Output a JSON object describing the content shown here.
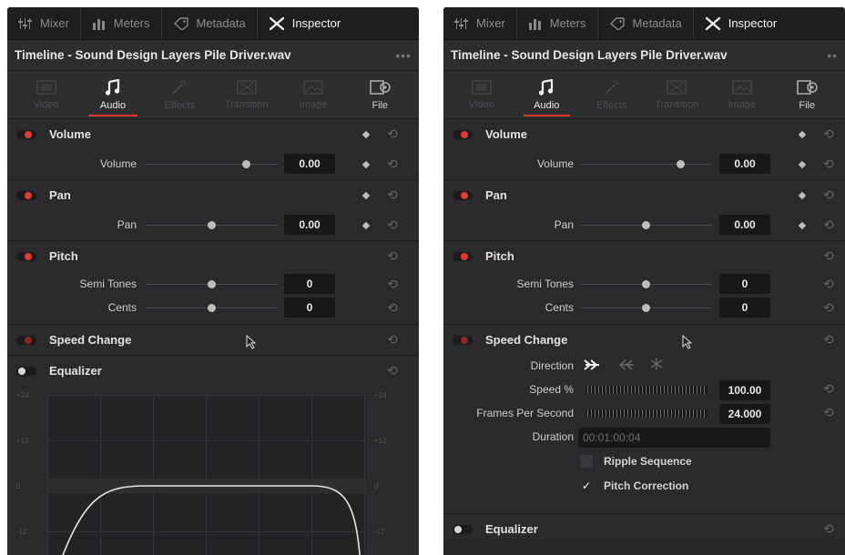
{
  "tabs_top": [
    "Mixer",
    "Meters",
    "Metadata",
    "Inspector"
  ],
  "title": "Timeline - Sound Design Layers Pile Driver.wav",
  "inspector_tabs": [
    "Video",
    "Audio",
    "Effects",
    "Transition",
    "Image",
    "File"
  ],
  "volume": {
    "section": "Volume",
    "label": "Volume",
    "value": "0.00"
  },
  "pan": {
    "section": "Pan",
    "label": "Pan",
    "value": "0.00"
  },
  "pitch": {
    "section": "Pitch",
    "semi_label": "Semi Tones",
    "semi_value": "0",
    "cents_label": "Cents",
    "cents_value": "0"
  },
  "speed_change": {
    "section": "Speed Change",
    "direction_label": "Direction",
    "speed_label": "Speed %",
    "speed_value": "100.00",
    "fps_label": "Frames Per Second",
    "fps_value": "24.000",
    "duration_label": "Duration",
    "duration_value": "00:01:00:04",
    "ripple_label": "Ripple Sequence",
    "ripple_checked": false,
    "pitch_correction_label": "Pitch Correction",
    "pitch_correction_checked": true
  },
  "equalizer": {
    "section": "Equalizer",
    "axis": [
      "+24",
      "+12",
      "0",
      "-12"
    ]
  },
  "colors": {
    "accent": "#e03b2c",
    "panel": "#28282b",
    "field": "#18181a"
  }
}
